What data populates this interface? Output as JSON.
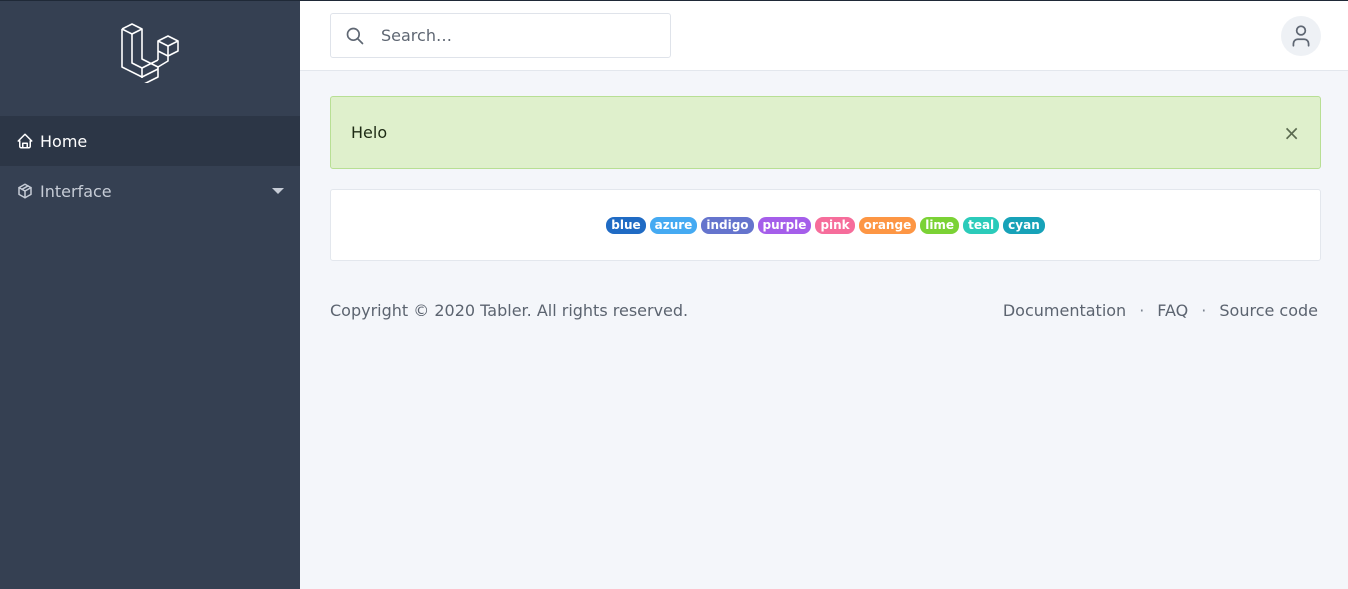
{
  "sidebar": {
    "logo_icon": "laravel-cubes-icon",
    "items": [
      {
        "label": "Home",
        "icon": "home-icon",
        "active": true
      },
      {
        "label": "Interface",
        "icon": "package-icon",
        "active": false
      }
    ]
  },
  "topbar": {
    "search": {
      "placeholder": "Search…",
      "value": ""
    },
    "avatar_icon": "user-icon"
  },
  "alert": {
    "message": "Helo",
    "close_label": "×"
  },
  "badges": [
    {
      "label": "blue",
      "color": "#206bc4"
    },
    {
      "label": "azure",
      "color": "#45aaf2"
    },
    {
      "label": "indigo",
      "color": "#6574cd"
    },
    {
      "label": "purple",
      "color": "#a55eea"
    },
    {
      "label": "pink",
      "color": "#f66d9b"
    },
    {
      "label": "orange",
      "color": "#fd9644"
    },
    {
      "label": "lime",
      "color": "#7bd235"
    },
    {
      "label": "teal",
      "color": "#2bcbba"
    },
    {
      "label": "cyan",
      "color": "#17a2b8"
    }
  ],
  "footer": {
    "copyright": "Copyright © 2020 Tabler. All rights reserved.",
    "links": [
      "Documentation",
      "FAQ",
      "Source code"
    ],
    "separator": "·"
  }
}
